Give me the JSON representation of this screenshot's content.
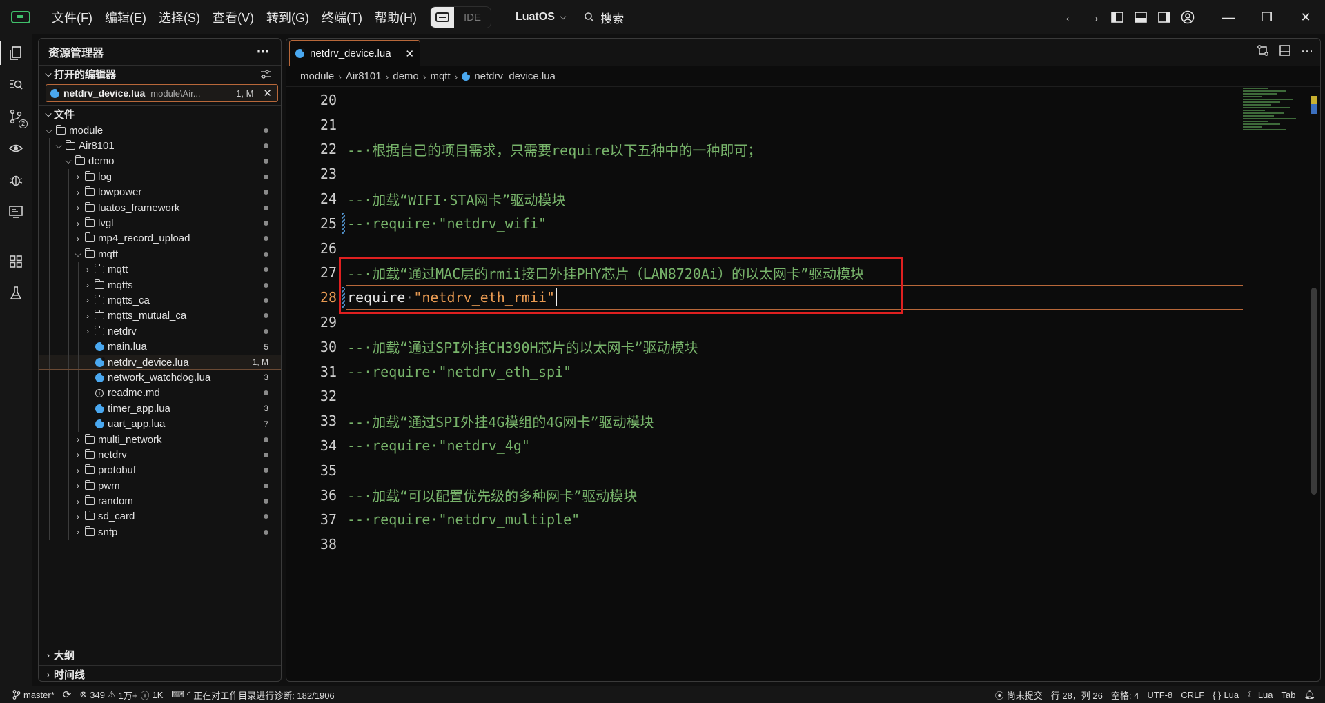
{
  "titlebar": {
    "menu": [
      "文件(F)",
      "编辑(E)",
      "选择(S)",
      "查看(V)",
      "转到(G)",
      "终端(T)",
      "帮助(H)"
    ],
    "ide_label": "IDE",
    "workspace": "LuatOS",
    "search_label": "搜索"
  },
  "activity": {
    "icons": [
      "explorer-icon",
      "search-icon",
      "source-control-icon",
      "eye-icon",
      "debug-icon",
      "remote-icon",
      "extensions-icon",
      "test-icon"
    ],
    "scm_badge": "2"
  },
  "sidebar": {
    "title": "资源管理器",
    "open_editors_title": "打开的编辑器",
    "open_editor": {
      "name": "netdrv_device.lua",
      "path": "module\\Air...",
      "badge": "1, M"
    },
    "files_title": "文件",
    "tree": [
      {
        "label": "module",
        "depth": 0,
        "kind": "folder",
        "open": true,
        "badge": ""
      },
      {
        "label": "Air8101",
        "depth": 1,
        "kind": "folder",
        "open": true,
        "badge": ""
      },
      {
        "label": "demo",
        "depth": 2,
        "kind": "folder",
        "open": true,
        "badge": ""
      },
      {
        "label": "log",
        "depth": 3,
        "kind": "folder",
        "open": false,
        "badge": ""
      },
      {
        "label": "lowpower",
        "depth": 3,
        "kind": "folder",
        "open": false,
        "badge": ""
      },
      {
        "label": "luatos_framework",
        "depth": 3,
        "kind": "folder",
        "open": false,
        "badge": ""
      },
      {
        "label": "lvgl",
        "depth": 3,
        "kind": "folder",
        "open": false,
        "badge": ""
      },
      {
        "label": "mp4_record_upload",
        "depth": 3,
        "kind": "folder",
        "open": false,
        "badge": ""
      },
      {
        "label": "mqtt",
        "depth": 3,
        "kind": "folder",
        "open": true,
        "badge": ""
      },
      {
        "label": "mqtt",
        "depth": 4,
        "kind": "folder",
        "open": false,
        "badge": ""
      },
      {
        "label": "mqtts",
        "depth": 4,
        "kind": "folder",
        "open": false,
        "badge": ""
      },
      {
        "label": "mqtts_ca",
        "depth": 4,
        "kind": "folder",
        "open": false,
        "badge": ""
      },
      {
        "label": "mqtts_mutual_ca",
        "depth": 4,
        "kind": "folder",
        "open": false,
        "badge": ""
      },
      {
        "label": "netdrv",
        "depth": 4,
        "kind": "folder",
        "open": false,
        "badge": ""
      },
      {
        "label": "main.lua",
        "depth": 4,
        "kind": "lua",
        "badge": "5"
      },
      {
        "label": "netdrv_device.lua",
        "depth": 4,
        "kind": "lua",
        "badge": "1, M",
        "selected": true
      },
      {
        "label": "network_watchdog.lua",
        "depth": 4,
        "kind": "lua",
        "badge": "3"
      },
      {
        "label": "readme.md",
        "depth": 4,
        "kind": "info",
        "badge": ""
      },
      {
        "label": "timer_app.lua",
        "depth": 4,
        "kind": "lua",
        "badge": "3"
      },
      {
        "label": "uart_app.lua",
        "depth": 4,
        "kind": "lua",
        "badge": "7"
      },
      {
        "label": "multi_network",
        "depth": 3,
        "kind": "folder",
        "open": false,
        "badge": ""
      },
      {
        "label": "netdrv",
        "depth": 3,
        "kind": "folder",
        "open": false,
        "badge": ""
      },
      {
        "label": "protobuf",
        "depth": 3,
        "kind": "folder",
        "open": false,
        "badge": ""
      },
      {
        "label": "pwm",
        "depth": 3,
        "kind": "folder",
        "open": false,
        "badge": ""
      },
      {
        "label": "random",
        "depth": 3,
        "kind": "folder",
        "open": false,
        "badge": ""
      },
      {
        "label": "sd_card",
        "depth": 3,
        "kind": "folder",
        "open": false,
        "badge": ""
      },
      {
        "label": "sntp",
        "depth": 3,
        "kind": "folder",
        "open": false,
        "badge": ""
      }
    ],
    "outline_title": "大纲",
    "timeline_title": "时间线"
  },
  "editor": {
    "tab_name": "netdrv_device.lua",
    "breadcrumb": [
      "module",
      "Air8101",
      "demo",
      "mqtt",
      "netdrv_device.lua"
    ],
    "current_line": 28,
    "lines": [
      {
        "n": 20,
        "tokens": []
      },
      {
        "n": 21,
        "tokens": []
      },
      {
        "n": 22,
        "tokens": [
          {
            "t": "comment",
            "v": "--·根据自己的项目需求，只需要require以下五种中的一种即可；"
          }
        ]
      },
      {
        "n": 23,
        "tokens": []
      },
      {
        "n": 24,
        "tokens": [
          {
            "t": "comment",
            "v": "--·加载“WIFI·STA网卡”驱动模块"
          }
        ]
      },
      {
        "n": 25,
        "mod": true,
        "tokens": [
          {
            "t": "comment",
            "v": "--·require·\"netdrv_wifi\""
          }
        ]
      },
      {
        "n": 26,
        "tokens": []
      },
      {
        "n": 27,
        "tokens": [
          {
            "t": "comment",
            "v": "--·加载“通过MAC层的rmii接口外挂PHY芯片（LAN8720Ai）的以太网卡”驱动模块"
          }
        ]
      },
      {
        "n": 28,
        "mod": true,
        "tokens": [
          {
            "t": "kw",
            "v": "require"
          },
          {
            "t": "ws",
            "v": "·"
          },
          {
            "t": "str",
            "v": "\"netdrv_eth_rmii\""
          }
        ]
      },
      {
        "n": 29,
        "tokens": []
      },
      {
        "n": 30,
        "tokens": [
          {
            "t": "comment",
            "v": "--·加载“通过SPI外挂CH390H芯片的以太网卡”驱动模块"
          }
        ]
      },
      {
        "n": 31,
        "tokens": [
          {
            "t": "comment",
            "v": "--·require·\"netdrv_eth_spi\""
          }
        ]
      },
      {
        "n": 32,
        "tokens": []
      },
      {
        "n": 33,
        "tokens": [
          {
            "t": "comment",
            "v": "--·加载“通过SPI外挂4G模组的4G网卡”驱动模块"
          }
        ]
      },
      {
        "n": 34,
        "tokens": [
          {
            "t": "comment",
            "v": "--·require·\"netdrv_4g\""
          }
        ]
      },
      {
        "n": 35,
        "tokens": []
      },
      {
        "n": 36,
        "tokens": [
          {
            "t": "comment",
            "v": "--·加载“可以配置优先级的多种网卡”驱动模块"
          }
        ]
      },
      {
        "n": 37,
        "tokens": [
          {
            "t": "comment",
            "v": "--·require·\"netdrv_multiple\""
          }
        ]
      },
      {
        "n": 38,
        "tokens": []
      }
    ]
  },
  "statusbar": {
    "branch": "master*",
    "errors": "349",
    "warnings": "1万+",
    "infos": "1K",
    "diagnostics": "正在对工作目录进行诊断: 182/1906",
    "commit": "尚未提交",
    "position": "行 28，列 26",
    "indent": "空格: 4",
    "encoding": "UTF-8",
    "eol": "CRLF",
    "language": "Lua",
    "lua_server": "Lua",
    "tab": "Tab"
  },
  "colors": {
    "accent": "#b8683a",
    "comment": "#77b36a",
    "string": "#e89a52",
    "highlight_box": "#e02020"
  }
}
